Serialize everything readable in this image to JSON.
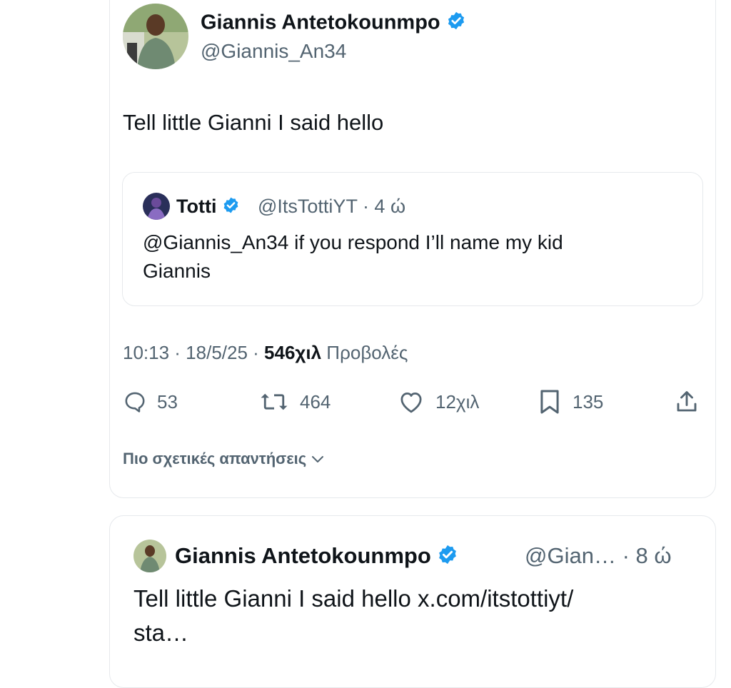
{
  "main_tweet": {
    "author_name": "Giannis Antetokounmpo",
    "author_handle": "@Giannis_An34",
    "verified": true,
    "text": "Tell little Gianni I said hello",
    "time": "10:13 · 18/5/25 · ",
    "views_count": "546χιλ",
    "views_label": " Προβολές",
    "actions": {
      "replies": "53",
      "reposts": "464",
      "likes": "12χιλ",
      "bookmarks": "135"
    },
    "more_replies_label": "Πιο σχετικές απαντήσεις"
  },
  "quoted_tweet": {
    "author_name": "Totti",
    "author_handle": "@ItsTottiYT · 4 ώ",
    "verified": true,
    "text_line1": "@Giannis_An34 if you respond I’ll name my kid",
    "text_line2": "Giannis"
  },
  "reply_tweet": {
    "author_name": "Giannis Antetokounmpo",
    "author_handle": "@Gian… · 8 ώ",
    "verified": true,
    "text_line1": "Tell little Gianni I said hello x.com/itstottiyt/",
    "text_line2": "sta…"
  },
  "colors": {
    "verified_blue": "#1d9bf0",
    "secondary_text": "#536471",
    "primary_text": "#0f1419",
    "border": "#e6e9ec"
  }
}
